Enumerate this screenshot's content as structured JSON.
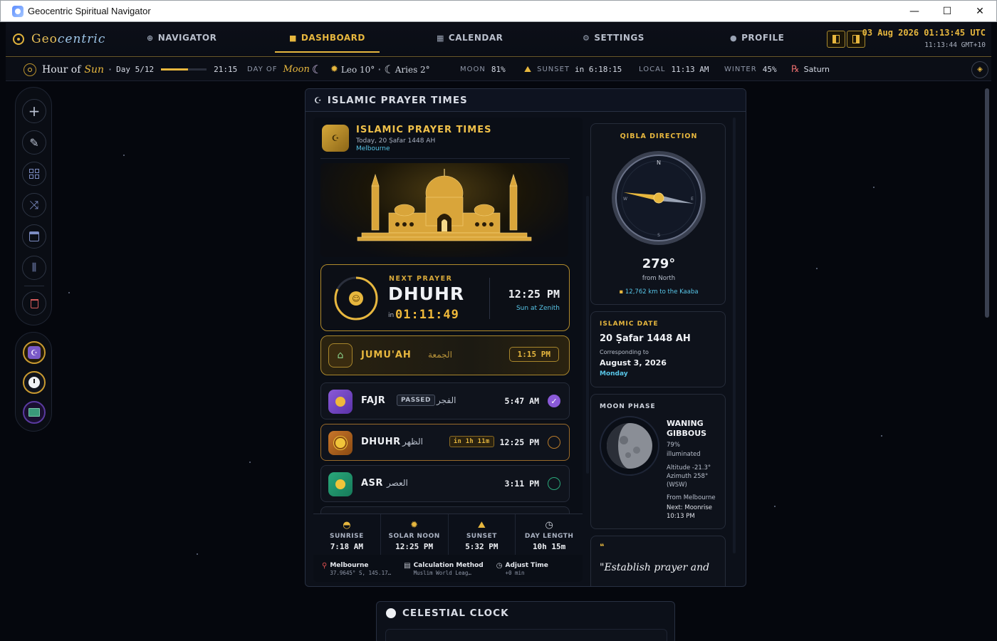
{
  "window": {
    "title": "Geocentric Spiritual Navigator",
    "min": "—",
    "max": "☐",
    "close": "✕"
  },
  "nav": {
    "logo_a": "Geo",
    "logo_b": "centric",
    "items": [
      {
        "label": "NAVIGATOR",
        "icon": "globe-icon"
      },
      {
        "label": "DASHBOARD",
        "icon": "dashboard-icon"
      },
      {
        "label": "CALENDAR",
        "icon": "calendar-icon"
      },
      {
        "label": "SETTINGS",
        "icon": "gear-icon"
      },
      {
        "label": "PROFILE",
        "icon": "user-icon"
      }
    ],
    "clock_utc": "03 Aug 2026 01:13:45 UTC",
    "clock_local": "11:13:44 GMT+10"
  },
  "strip": {
    "hour_of": "Hour of",
    "hour_planet": "Sun",
    "day": "Day 5/12",
    "hour_time": "21:15",
    "day_of_label": "DAY OF",
    "day_of_value": "Moon",
    "sun_sign": "Leo 10°",
    "moon_sign": "Aries 2°",
    "moon_label": "MOON",
    "moon_value": "81%",
    "sunset_label": "SUNSET",
    "sunset_value": "in 6:18:15",
    "local_label": "LOCAL",
    "local_value": "11:13 AM",
    "season_label": "WINTER",
    "season_value": "45%",
    "retro_planet": "Saturn"
  },
  "card": {
    "header": "ISLAMIC PRAYER TIMES",
    "title": "ISLAMIC PRAYER TIMES",
    "subtitle": "Today, 20 Ṣafar 1448 AH",
    "city": "Melbourne",
    "next": {
      "label": "NEXT PRAYER",
      "name": "DHUHR",
      "in": "in",
      "countdown": "01:11:49",
      "time": "12:25 PM",
      "note": "Sun at Zenith"
    },
    "jumuah": {
      "name": "JUMU'AH",
      "arabic": "الجمعة",
      "time": "1:15 PM"
    },
    "prayers": [
      {
        "name": "FAJR",
        "arabic": "الفجر",
        "time": "5:47 AM",
        "badge": "PASSED"
      },
      {
        "name": "DHUHR",
        "arabic": "الظهر",
        "time": "12:25 PM",
        "badge": "in 1h 11m"
      },
      {
        "name": "ASR",
        "arabic": "العصر",
        "time": "3:11 PM",
        "badge": ""
      }
    ],
    "sun": [
      {
        "label": "SUNRISE",
        "value": "7:18 AM"
      },
      {
        "label": "SOLAR NOON",
        "value": "12:25 PM"
      },
      {
        "label": "SUNSET",
        "value": "5:32 PM"
      },
      {
        "label": "DAY LENGTH",
        "value": "10h 15m"
      }
    ],
    "footer": [
      {
        "label": "Melbourne",
        "value": "37.9645° S, 145.17…"
      },
      {
        "label": "Calculation Method",
        "value": "Muslim World Leag…"
      },
      {
        "label": "Adjust Time",
        "value": "+0 min"
      }
    ],
    "qibla": {
      "title": "QIBLA DIRECTION",
      "degrees": "279°",
      "from": "from North",
      "distance": "12,762 km to the Kaaba",
      "bearing_deg": 279
    },
    "islamic_date": {
      "title": "ISLAMIC DATE",
      "date": "20 Ṣafar 1448 AH",
      "corr": "Corresponding to",
      "greg": "August 3, 2026",
      "weekday": "Monday"
    },
    "moon": {
      "title": "MOON PHASE",
      "phase_1": "WANING",
      "phase_2": "GIBBOUS",
      "illum": "79%",
      "illum_label": "illuminated",
      "alt": "Altitude -21.3°",
      "az": "Azimuth 258°",
      "dir": "(WSW)",
      "from": "From Melbourne",
      "next": "Next: Moonrise",
      "next_time": "10:13 PM"
    },
    "quote": "\"Establish prayer and"
  },
  "celestial": {
    "title": "CELESTIAL CLOCK"
  },
  "colors": {
    "accent": "#e7b73e",
    "cyan": "#58c6e8",
    "bg": "#05070d"
  }
}
